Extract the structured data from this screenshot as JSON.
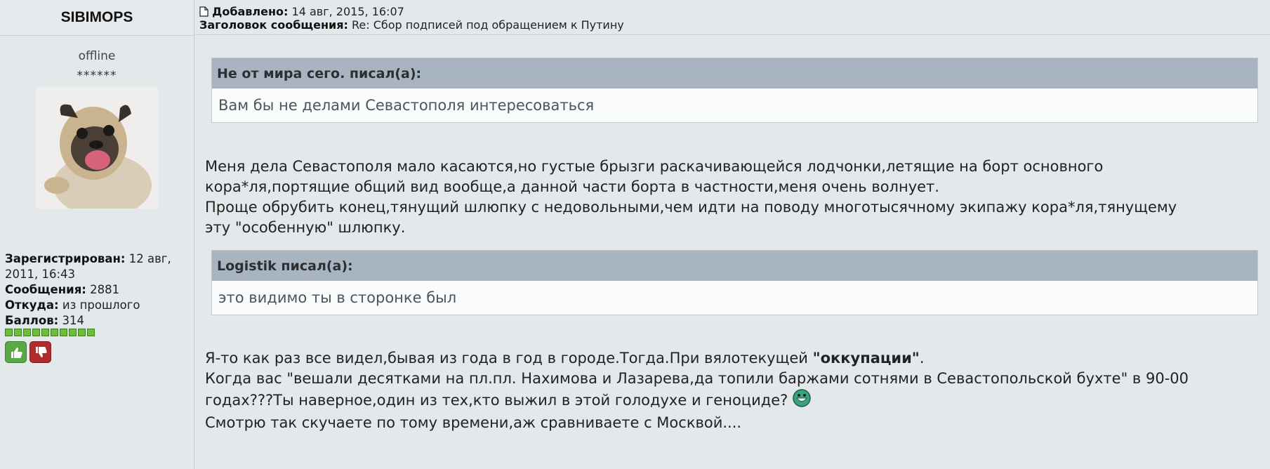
{
  "author": {
    "username": "SIBIMOPS",
    "status": "offline",
    "rank_stars": "******",
    "registered_label": "Зарегистрирован:",
    "registered_value": " 12 авг, 2011, 16:43",
    "posts_label": "Сообщения:",
    "posts_value": " 2881",
    "from_label": "Откуда:",
    "from_value": " из прошлого",
    "points_label": "Баллов:",
    "points_value": " 314",
    "level_blocks": 10,
    "avatar_icon": "pug-avatar-image",
    "vote_up_icon": "thumbs-up-icon",
    "vote_down_icon": "thumbs-down-icon"
  },
  "post": {
    "added_label": "Добавлено:",
    "added_value": " 14 авг, 2015, 16:07",
    "subject_label": "Заголовок сообщения:",
    "subject_value": " Re: Сбор подписей под обращением к Путину",
    "doc_icon": "document-icon"
  },
  "quotes": [
    {
      "head": "Не от мира сего. писал(а):",
      "body": "Вам бы не делами Севастополя интересоваться"
    },
    {
      "head": "Logistik писал(а):",
      "body": "это видимо ты в сторонке был"
    }
  ],
  "paragraphs": {
    "p1_line1": "Меня дела Севастополя мало касаются,но густые брызги раскачивающейся лодчонки,летящие на борт основного",
    "p1_line2": "кора*ля,портящие общий вид вообще,а данной части борта в частности,меня очень волнует.",
    "p1_line3": "Проще обрубить конец,тянущий шлюпку с недовольными,чем идти на поводу многотысячному экипажу кора*ля,тянущему",
    "p1_line4": "эту \"особенную\" шлюпку.",
    "p2_line1_a": "Я-то как раз все видел,бывая из года в год в городе.Тогда.При вялотекущей ",
    "p2_line1_b": "\"оккупации\"",
    "p2_line1_c": ".",
    "p2_line2": "Когда вас \"вешали десятками на пл.пл. Нахимова и Лазарева,да топили баржами сотнями в Севастопольской бухте\" в 90-00",
    "p2_line3": "годах???Ты наверное,один из тех,кто выжил в этой голодухе и геноциде? ",
    "p2_line4": "Смотрю так скучаете по тому времени,аж сравниваете с Москвой....",
    "smiley_icon": "grinning-smiley-icon"
  },
  "colors": {
    "page_bg": "#e3e8eb",
    "quote_header_bg": "#a8b5c0",
    "quote_body_bg": "#fafbfb",
    "level_green": "#6bbf3c",
    "vote_up": "#5ba846",
    "vote_down": "#b02b2b"
  }
}
